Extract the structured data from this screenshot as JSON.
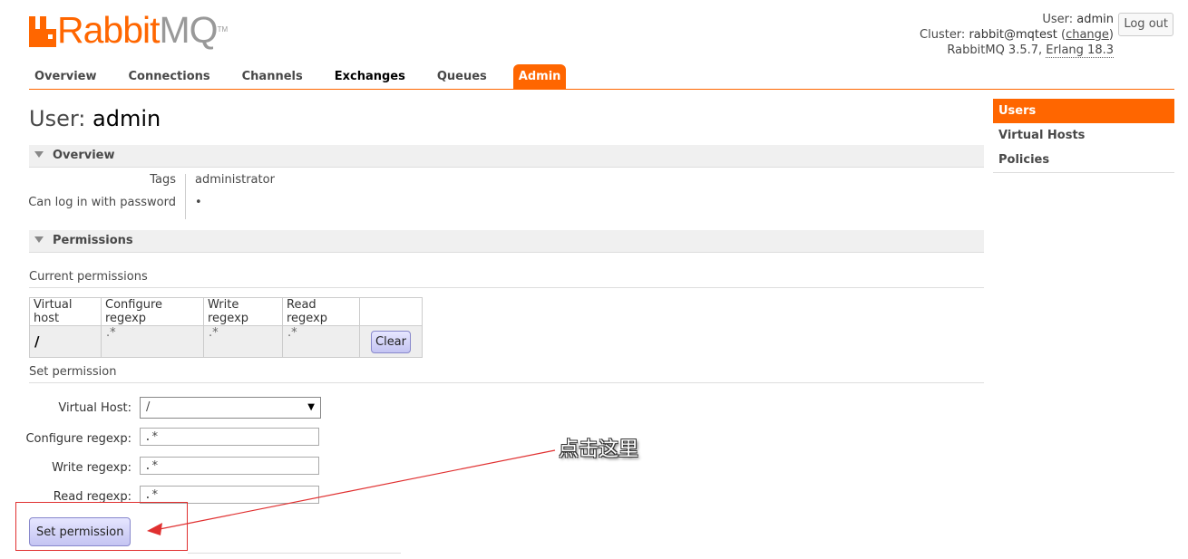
{
  "header": {
    "logo_main": "Rabbit",
    "logo_mq": "MQ",
    "logo_tm": "TM",
    "user_label": "User:",
    "user_value": "admin",
    "cluster_label": "Cluster:",
    "cluster_value": "rabbit@mqtest",
    "change_link": "change",
    "version_text": "RabbitMQ 3.5.7,",
    "erlang_text": "Erlang 18.3",
    "logout_label": "Log out"
  },
  "nav": {
    "tabs": [
      {
        "label": "Overview"
      },
      {
        "label": "Connections"
      },
      {
        "label": "Channels"
      },
      {
        "label": "Exchanges"
      },
      {
        "label": "Queues"
      },
      {
        "label": "Admin"
      }
    ]
  },
  "page": {
    "title_prefix": "User:",
    "title_name": "admin"
  },
  "overview": {
    "header": "Overview",
    "tags_label": "Tags",
    "tags_value": "administrator",
    "login_label": "Can log in with password",
    "login_value": "•"
  },
  "permissions": {
    "header": "Permissions",
    "current_heading": "Current permissions",
    "columns": [
      "Virtual host",
      "Configure regexp",
      "Write regexp",
      "Read regexp"
    ],
    "rows": [
      {
        "vhost": "/",
        "configure": ".*",
        "write": ".*",
        "read": ".*",
        "action": "Clear"
      }
    ],
    "set_heading": "Set permission",
    "form": {
      "vhost_label": "Virtual Host:",
      "vhost_value": "/",
      "configure_label": "Configure regexp:",
      "configure_value": ".*",
      "write_label": "Write regexp:",
      "write_value": ".*",
      "read_label": "Read regexp:",
      "read_value": ".*",
      "submit_label": "Set permission"
    }
  },
  "sidebar": {
    "items": [
      {
        "label": "Users"
      },
      {
        "label": "Virtual Hosts"
      },
      {
        "label": "Policies"
      }
    ]
  },
  "annotation": {
    "text": "点击这里",
    "color": "#e03030"
  },
  "colors": {
    "accent": "#ff6600",
    "button": "#c4c4f2"
  }
}
